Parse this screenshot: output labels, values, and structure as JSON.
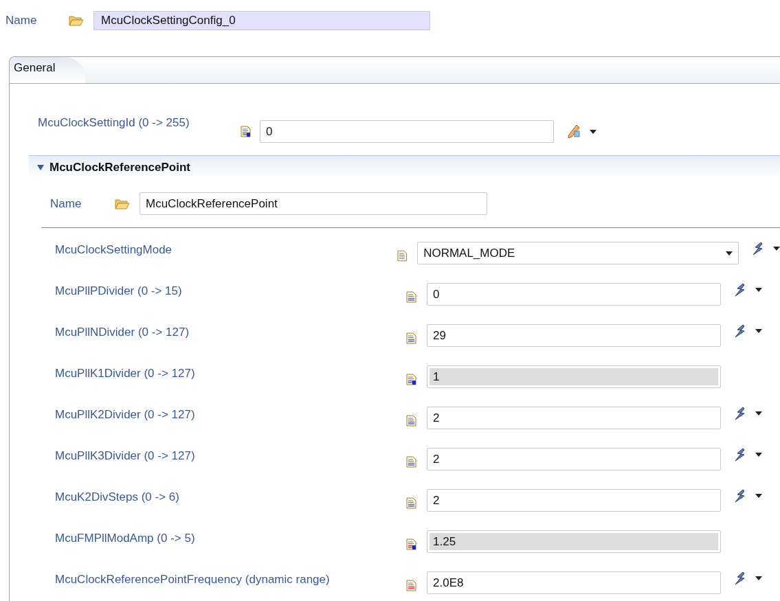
{
  "name": {
    "label": "Name",
    "value": "McuClockSettingConfig_0"
  },
  "tabs": [
    {
      "label": "General",
      "selected": true
    }
  ],
  "setting_id": {
    "label": "McuClockSettingId (0 -> 255)",
    "value": "0",
    "kind": "integer-derived"
  },
  "section": {
    "title": "McuClockReferencePoint",
    "expanded": true,
    "name": {
      "label": "Name",
      "value": "McuClockReferencePoint"
    },
    "params": [
      {
        "label": "McuClockSettingMode",
        "kind": "enum",
        "value": "NORMAL_MODE",
        "disabled": false
      },
      {
        "label": "McuPllPDivider (0 -> 15)",
        "kind": "integer",
        "value": "0",
        "disabled": false
      },
      {
        "label": "McuPllNDivider (0 -> 127)",
        "kind": "integer",
        "value": "29",
        "disabled": false
      },
      {
        "label": "McuPllK1Divider (0 -> 127)",
        "kind": "integer-derived",
        "value": "1",
        "disabled": true
      },
      {
        "label": "McuPllK2Divider (0 -> 127)",
        "kind": "integer",
        "value": "2",
        "disabled": false
      },
      {
        "label": "McuPllK3Divider (0 -> 127)",
        "kind": "integer",
        "value": "2",
        "disabled": false
      },
      {
        "label": "McuK2DivSteps (0 -> 6)",
        "kind": "integer",
        "value": "2",
        "disabled": false
      },
      {
        "label": "McuFMPllModAmp (0 -> 5)",
        "kind": "float-derived",
        "value": "1.25",
        "disabled": true
      },
      {
        "label": "McuClockReferencePointFrequency (dynamic range)",
        "kind": "float",
        "value": "2.0E8",
        "disabled": false
      }
    ]
  }
}
